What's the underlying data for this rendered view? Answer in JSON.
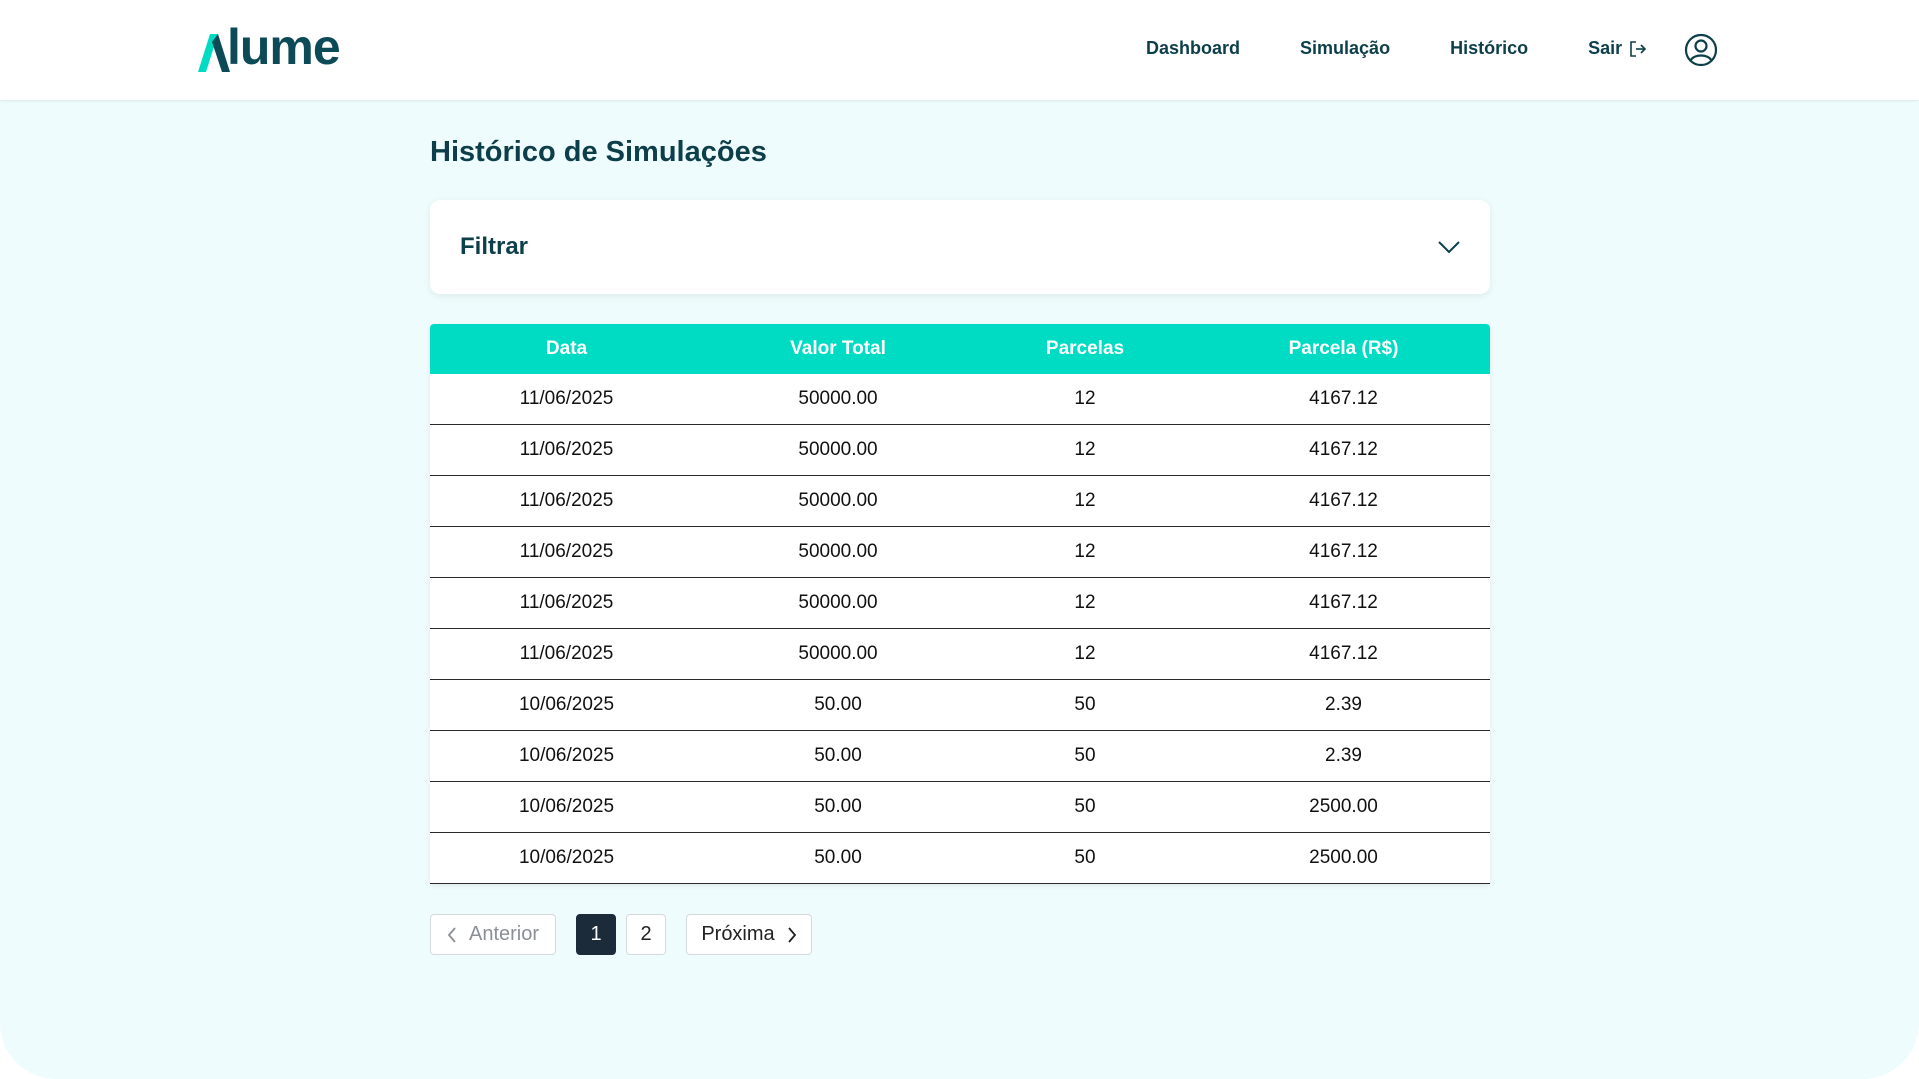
{
  "brand": {
    "name": "lume",
    "accent": "#00dcc4",
    "dark": "#0d3f4a"
  },
  "nav": {
    "items": [
      {
        "label": "Dashboard"
      },
      {
        "label": "Simulação"
      },
      {
        "label": "Histórico"
      },
      {
        "label": "Sair",
        "icon": "logout-icon"
      }
    ],
    "avatar_icon": "user-circle-icon"
  },
  "main": {
    "title": "Histórico de Simulações",
    "filter": {
      "label": "Filtrar",
      "icon": "chevron-down-icon"
    },
    "table": {
      "columns": [
        "Data",
        "Valor Total",
        "Parcelas",
        "Parcela (R$)"
      ],
      "rows": [
        [
          "11/06/2025",
          "50000.00",
          "12",
          "4167.12"
        ],
        [
          "11/06/2025",
          "50000.00",
          "12",
          "4167.12"
        ],
        [
          "11/06/2025",
          "50000.00",
          "12",
          "4167.12"
        ],
        [
          "11/06/2025",
          "50000.00",
          "12",
          "4167.12"
        ],
        [
          "11/06/2025",
          "50000.00",
          "12",
          "4167.12"
        ],
        [
          "11/06/2025",
          "50000.00",
          "12",
          "4167.12"
        ],
        [
          "10/06/2025",
          "50.00",
          "50",
          "2.39"
        ],
        [
          "10/06/2025",
          "50.00",
          "50",
          "2.39"
        ],
        [
          "10/06/2025",
          "50.00",
          "50",
          "2500.00"
        ],
        [
          "10/06/2025",
          "50.00",
          "50",
          "2500.00"
        ]
      ]
    },
    "pagination": {
      "prev_label": "Anterior",
      "next_label": "Próxima",
      "pages": [
        "1",
        "2"
      ],
      "current": "1"
    }
  }
}
